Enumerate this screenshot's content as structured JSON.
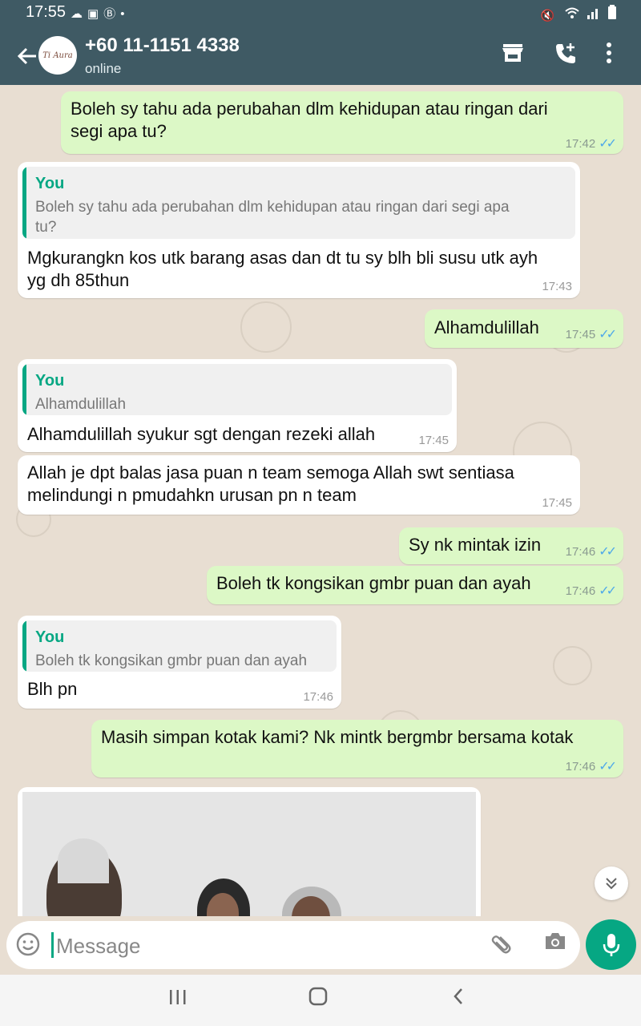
{
  "status_bar": {
    "time": "17:55",
    "left_icons": [
      "cloud-icon",
      "image-icon",
      "b-badge-icon",
      "dot-icon"
    ],
    "right_icons": [
      "mute-vibrate-icon",
      "wifi-icon",
      "signal-icon",
      "battery-icon"
    ]
  },
  "header": {
    "contact_name": "+60 11-1151 4338",
    "contact_status": "online",
    "avatar_text": "Ti Aura",
    "icons": [
      "back-arrow-icon",
      "shop-icon",
      "add-call-icon",
      "more-vert-icon"
    ]
  },
  "colors": {
    "header_bg": "#3f5a64",
    "accent": "#06a783",
    "outgoing_bubble": "#dcf8c6",
    "incoming_bubble": "#ffffff",
    "read_tick": "#4fa9e9"
  },
  "messages": [
    {
      "dir": "out",
      "text": "Boleh sy tahu ada perubahan dlm kehidupan atau ringan dari\nsegi apa tu?",
      "time": "17:42",
      "ticks": "✓✓"
    },
    {
      "dir": "in",
      "quote_name": "You",
      "quote_text": "Boleh sy tahu ada perubahan dlm kehidupan atau ringan dari segi apa\ntu?",
      "text": "Mgkurangkn kos utk barang asas dan dt tu sy blh bli susu utk ayh\nyg dh 85thun",
      "time": "17:43"
    },
    {
      "dir": "out",
      "text": "Alhamdulillah",
      "time": "17:45",
      "ticks": "✓✓"
    },
    {
      "dir": "in",
      "quote_name": "You",
      "quote_text": "Alhamdulillah",
      "text": "Alhamdulillah syukur sgt dengan rezeki allah",
      "time": "17:45"
    },
    {
      "dir": "in",
      "text": "Allah je dpt balas jasa puan n team semoga Allah swt sentiasa\nmelindungi n pmudahkn urusan pn n team",
      "time": "17:45"
    },
    {
      "dir": "out",
      "text": "Sy nk mintak izin",
      "time": "17:46",
      "ticks": "✓✓"
    },
    {
      "dir": "out",
      "text": "Boleh tk kongsikan gmbr puan dan ayah",
      "time": "17:46",
      "ticks": "✓✓"
    },
    {
      "dir": "in",
      "quote_name": "You",
      "quote_text": "Boleh tk kongsikan gmbr puan dan ayah",
      "text": "Blh pn",
      "time": "17:46"
    },
    {
      "dir": "out",
      "text": "Masih simpan kotak kami? Nk mintk bergmbr bersama kotak",
      "time": "17:46",
      "ticks": "✓✓"
    }
  ],
  "photo_message": {
    "dir": "in",
    "content": "photo of three people"
  },
  "input": {
    "placeholder": "Message",
    "value": ""
  },
  "nav": {
    "icons": [
      "recent-apps-icon",
      "home-icon",
      "back-icon"
    ]
  }
}
